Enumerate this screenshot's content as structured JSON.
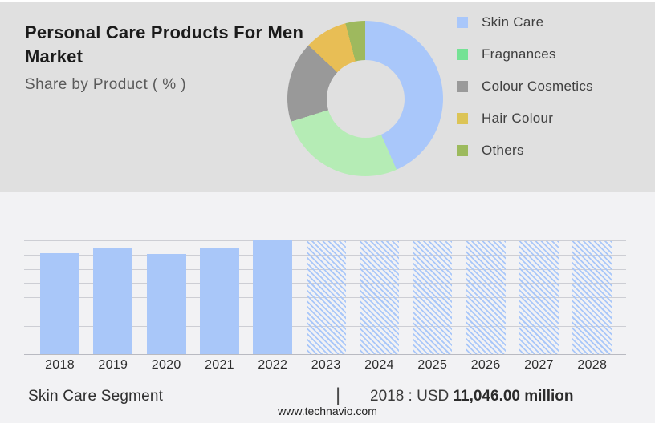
{
  "header": {
    "title_lines": [
      "Personal Care Products For Men",
      "Market"
    ],
    "subtitle": "Share by Product ( % )"
  },
  "colors": {
    "top_background": "#e0e0e0",
    "bottom_background": "#f2f2f4",
    "bar_blue": "#a9c7f9",
    "gridline": "#cdced4",
    "baseline": "#b9bac1"
  },
  "chart_data": [
    {
      "type": "pie",
      "donut": true,
      "title": "Share by Product ( % )",
      "legend_position": "right",
      "segments": [
        {
          "label": "Skin Care",
          "percent": 43.4,
          "color": "#a9c7fa",
          "legend_color": "#a9c7fa"
        },
        {
          "label": "Fragnances",
          "percent": 26.8,
          "color": "#b5ecb5",
          "legend_color": "#75e295"
        },
        {
          "label": "Colour Cosmetics",
          "percent": 16.8,
          "color": "#999999",
          "legend_color": "#9a9a9a"
        },
        {
          "label": "Hair Colour",
          "percent": 8.9,
          "color": "#e8be55",
          "legend_color": "#dcc456"
        },
        {
          "label": "Others",
          "percent": 4.1,
          "color": "#9eb95e",
          "legend_color": "#9cba5d"
        }
      ]
    },
    {
      "type": "bar",
      "title": "Skin Care Segment",
      "categories": [
        "2018",
        "2019",
        "2020",
        "2021",
        "2022",
        "2023",
        "2024",
        "2025",
        "2026",
        "2027",
        "2028"
      ],
      "values": [
        89.4,
        93.6,
        88.7,
        93.6,
        100.7,
        100,
        100,
        100,
        100,
        100,
        100
      ],
      "hatched": [
        false,
        false,
        false,
        false,
        false,
        true,
        true,
        true,
        true,
        true,
        true
      ],
      "value_scale": "relative height, top gridline = 100 (no y-axis labels shown)",
      "ylim": [
        0,
        100
      ],
      "grid": true,
      "annotation": "2018 : USD 11,046.00 million"
    }
  ],
  "footer": {
    "segment_label": "Skin Care Segment",
    "separator": "|",
    "value_prefix": "2018 : USD ",
    "value_bold": "11,046.00 million",
    "website": "www.technavio.com"
  }
}
